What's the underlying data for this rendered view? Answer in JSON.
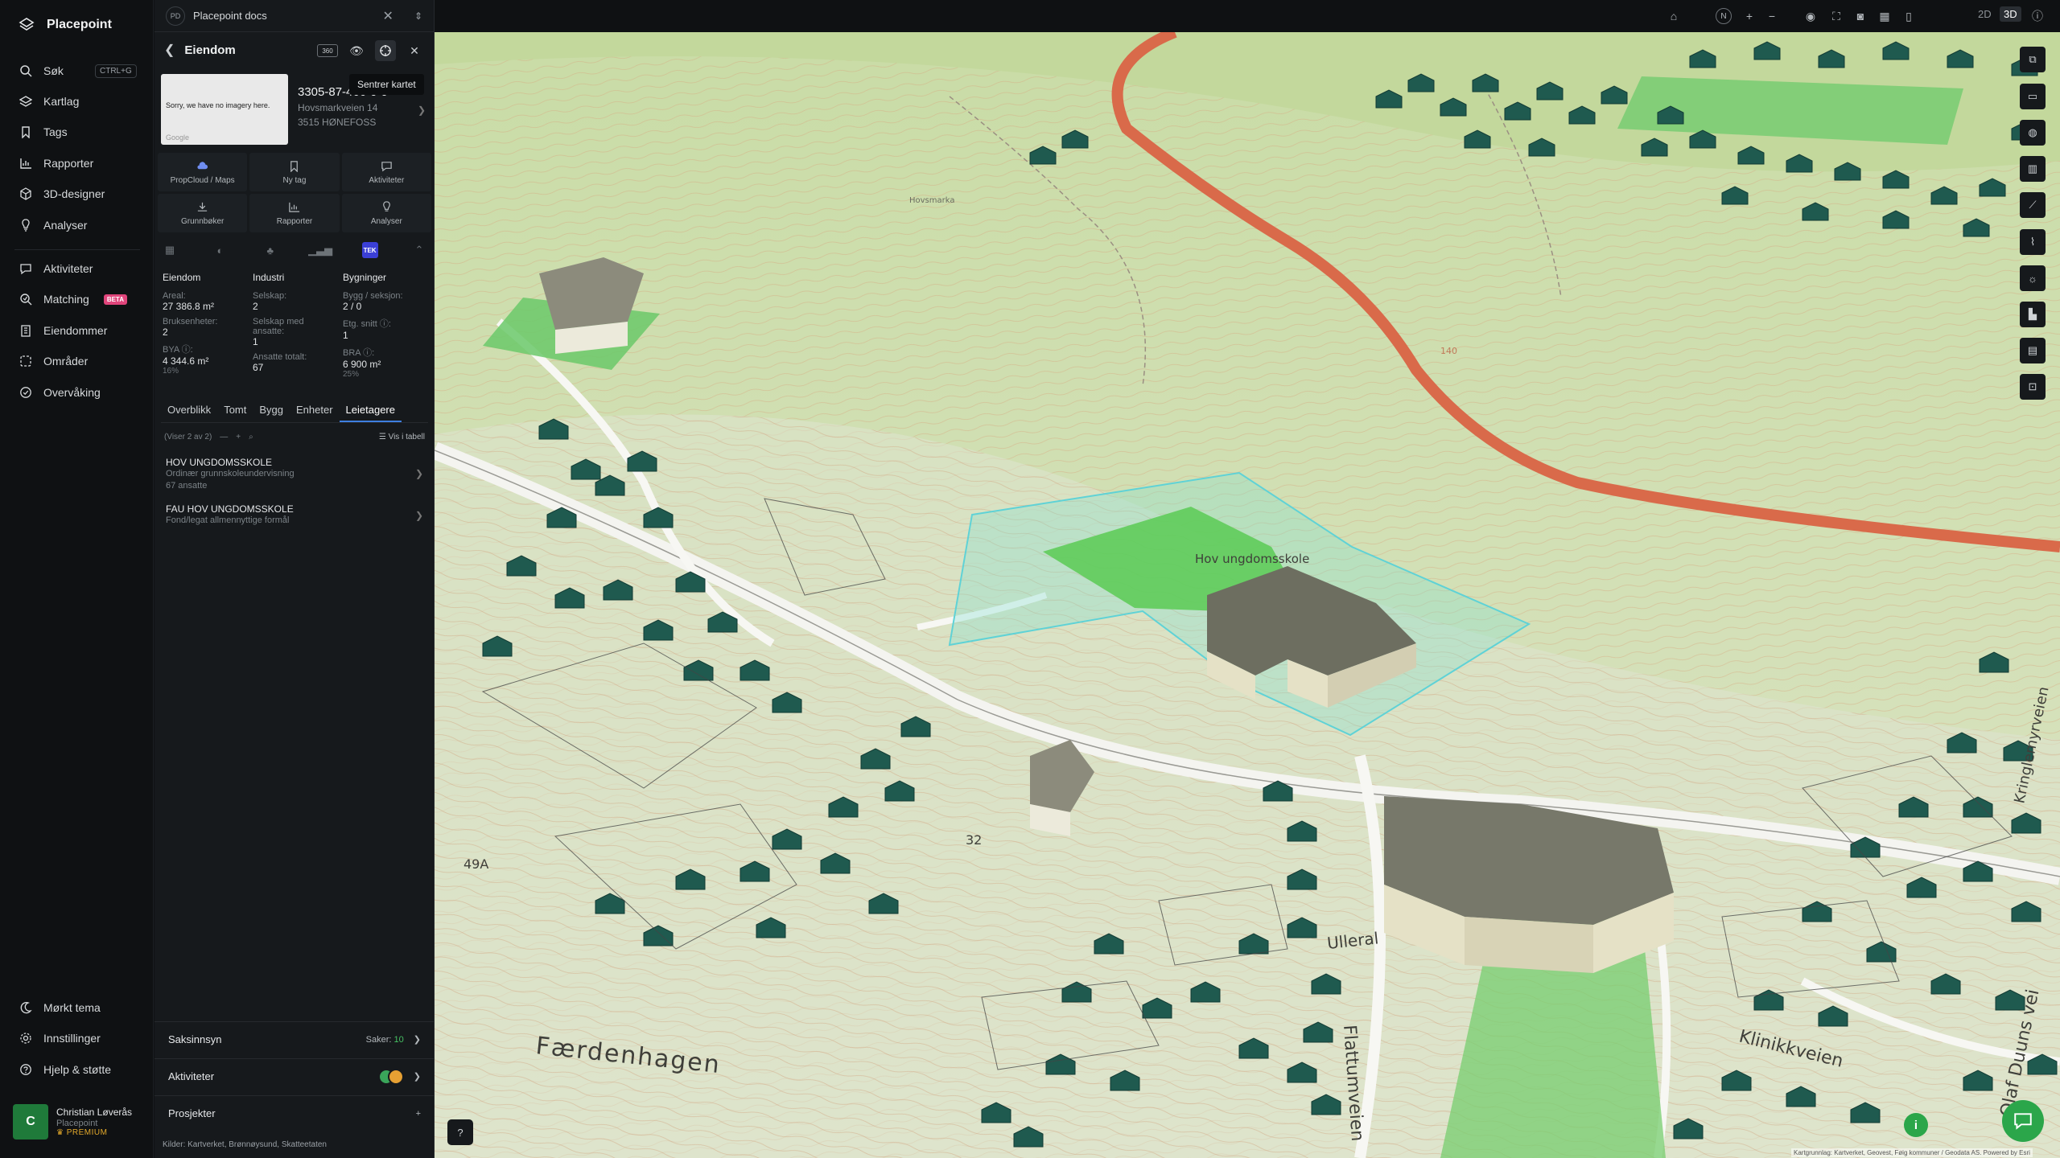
{
  "app": {
    "name": "Placepoint"
  },
  "nav": {
    "items": [
      {
        "label": "Søk",
        "shortcut": "CTRL+G"
      },
      {
        "label": "Kartlag"
      },
      {
        "label": "Tags"
      },
      {
        "label": "Rapporter"
      },
      {
        "label": "3D-designer"
      },
      {
        "label": "Analyser"
      },
      {
        "label": "Aktiviteter"
      },
      {
        "label": "Matching",
        "badge": "BETA"
      },
      {
        "label": "Eiendommer"
      },
      {
        "label": "Områder"
      },
      {
        "label": "Overvåking"
      }
    ],
    "bottom": [
      {
        "label": "Mørkt tema"
      },
      {
        "label": "Innstillinger"
      },
      {
        "label": "Hjelp & støtte"
      }
    ],
    "user": {
      "initial": "C",
      "name": "Christian Løverås",
      "org": "Placepoint",
      "plan": "PREMIUM"
    }
  },
  "docs": {
    "badge": "PD",
    "title": "Placepoint docs"
  },
  "panel": {
    "title": "Eiendom",
    "badge_360": "360",
    "tooltip": "Sentrer kartet",
    "thumb": {
      "message": "Sorry, we have no imagery here.",
      "provider": "Google"
    },
    "property": {
      "id": "3305-87-466-0-0",
      "street": "Hovsmarkveien 14",
      "city": "3515 HØNEFOSS"
    },
    "actions": [
      {
        "label": "PropCloud / Maps",
        "icon": "cloud-icon"
      },
      {
        "label": "Ny tag",
        "icon": "bookmark-icon"
      },
      {
        "label": "Aktiviteter",
        "icon": "message-icon"
      },
      {
        "label": "Grunnbøker",
        "icon": "download-icon"
      },
      {
        "label": "Rapporter",
        "icon": "chart-icon"
      },
      {
        "label": "Analyser",
        "icon": "bulb-icon"
      }
    ],
    "tek_label": "TEK",
    "stats": {
      "eiendom": {
        "title": "Eiendom",
        "areal_label": "Areal:",
        "areal": "27 386.8 m²",
        "brukse_label": "Bruksenheter:",
        "brukse": "2",
        "bya_label": "BYA ⓘ:",
        "bya": "4 344.6 m²",
        "bya_pct": "16%"
      },
      "industri": {
        "title": "Industri",
        "selskap_label": "Selskap:",
        "selskap": "2",
        "ansatte_label": "Selskap med ansatte:",
        "ansatte": "1",
        "totalt_label": "Ansatte totalt:",
        "totalt": "67"
      },
      "bygninger": {
        "title": "Bygninger",
        "bygg_label": "Bygg / seksjon:",
        "bygg": "2 / 0",
        "etg_label": "Etg. snitt ⓘ:",
        "etg": "1",
        "bra_label": "BRA ⓘ:",
        "bra": "6 900 m²",
        "bra_pct": "25%"
      }
    },
    "tabs": [
      "Overblikk",
      "Tomt",
      "Bygg",
      "Enheter",
      "Leietagere"
    ],
    "selected_tab": "Leietagere",
    "list": {
      "count": "(Viser 2 av 2)",
      "table_link": "Vis i tabell",
      "rows": [
        {
          "name": "HOV UNGDOMSSKOLE",
          "desc": "Ordinær grunnskoleundervisning",
          "extra": "67 ansatte"
        },
        {
          "name": "FAU HOV UNGDOMSSKOLE",
          "desc": "Fond/legat allmennyttige formål",
          "extra": ""
        }
      ]
    },
    "sections": [
      {
        "label": "Saksinnsyn",
        "right_label": "Saker:",
        "right_value": "10"
      },
      {
        "label": "Aktiviteter"
      },
      {
        "label": "Prosjekter"
      }
    ],
    "sources": "Kilder: Kartverket, Brønnøysund, Skatteetaten"
  },
  "map": {
    "view_2d": "2D",
    "view_3d": "3D",
    "active_view": "3D",
    "compass": "N",
    "labels": {
      "school": "Hov ungdomsskole",
      "faerdenhagen": "Færdenhagen",
      "ulleral": "Ulleral",
      "flattumveien": "Flattumveien",
      "klinikkveien": "Klinikkveien",
      "olaf_duuns": "Olaf Duuns vei",
      "kringleveien": "Kringlemyrveien",
      "no32": "32",
      "no49a": "49A",
      "no140": "140",
      "hovsmarka": "Hovsmarka"
    },
    "attribution": "Kartgrunnlag: Kartverket, Geovest, Føig kommuner / Geodata AS. Powered by Esri",
    "colors": {
      "terrain": "#cfe0ad",
      "building": "#1f5a4f",
      "selection": "#6fd6d8",
      "road": "#d96a4a",
      "accent": "#2ba64a"
    }
  }
}
